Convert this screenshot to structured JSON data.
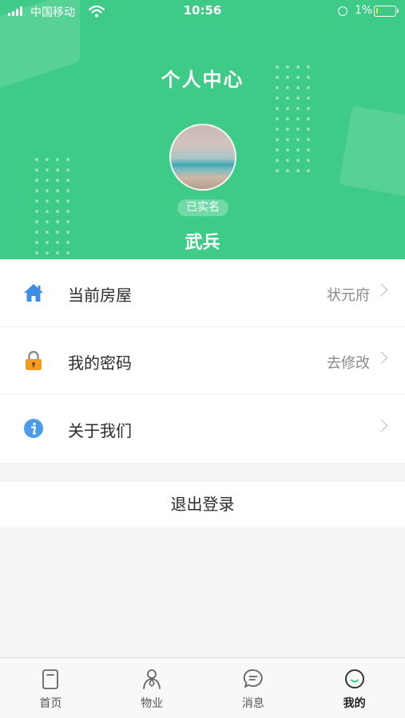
{
  "status_bar": {
    "carrier": "中国移动",
    "time": "10:56",
    "battery_percent": "1%"
  },
  "header": {
    "title": "个人中心",
    "verified_badge": "已实名",
    "user_name": "武兵",
    "background_color": "#3ecb87"
  },
  "menu": {
    "items": [
      {
        "label": "当前房屋",
        "value": "状元府",
        "icon": "house-icon",
        "icon_color": "#3d8fe6"
      },
      {
        "label": "我的密码",
        "value": "去修改",
        "icon": "lock-icon",
        "icon_color": "#f29c1f"
      },
      {
        "label": "关于我们",
        "value": "",
        "icon": "info-icon",
        "icon_color": "#4a9be8"
      }
    ]
  },
  "logout": {
    "label": "退出登录"
  },
  "tabbar": {
    "items": [
      {
        "label": "首页",
        "icon": "home-bag-icon",
        "active": false
      },
      {
        "label": "物业",
        "icon": "person-icon",
        "active": false
      },
      {
        "label": "消息",
        "icon": "message-icon",
        "active": false
      },
      {
        "label": "我的",
        "icon": "smile-icon",
        "active": true
      }
    ],
    "active_color": "#3ecb87"
  }
}
